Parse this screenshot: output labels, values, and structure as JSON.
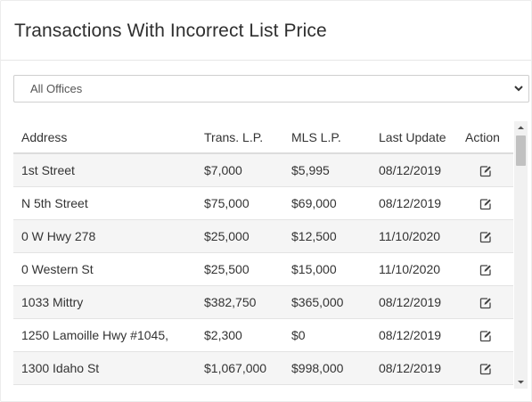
{
  "panel": {
    "title": "Transactions With Incorrect List Price"
  },
  "office_filter": {
    "selected": "All Offices"
  },
  "table": {
    "columns": [
      "Address",
      "Trans. L.P.",
      "MLS L.P.",
      "Last Update",
      "Action"
    ],
    "rows": [
      {
        "address": "1st Street",
        "trans_lp": "$7,000",
        "mls_lp": "$5,995",
        "last_update": "08/12/2019",
        "action_icon": "edit-icon"
      },
      {
        "address": "N 5th Street",
        "trans_lp": "$75,000",
        "mls_lp": "$69,000",
        "last_update": "08/12/2019",
        "action_icon": "edit-icon"
      },
      {
        "address": "0 W Hwy 278",
        "trans_lp": "$25,000",
        "mls_lp": "$12,500",
        "last_update": "11/10/2020",
        "action_icon": "edit-icon"
      },
      {
        "address": "0 Western St",
        "trans_lp": "$25,500",
        "mls_lp": "$15,000",
        "last_update": "11/10/2020",
        "action_icon": "edit-icon"
      },
      {
        "address": "1033 Mittry",
        "trans_lp": "$382,750",
        "mls_lp": "$365,000",
        "last_update": "08/12/2019",
        "action_icon": "edit-icon"
      },
      {
        "address": "1250 Lamoille Hwy #1045,",
        "trans_lp": "$2,300",
        "mls_lp": "$0",
        "last_update": "08/12/2019",
        "action_icon": "edit-icon"
      },
      {
        "address": "1300 Idaho St",
        "trans_lp": "$1,067,000",
        "mls_lp": "$998,000",
        "last_update": "08/12/2019",
        "action_icon": "edit-icon"
      }
    ]
  },
  "colors": {
    "row_stripe": "#f5f5f5",
    "border": "#e3e3e3",
    "text": "#333333"
  }
}
